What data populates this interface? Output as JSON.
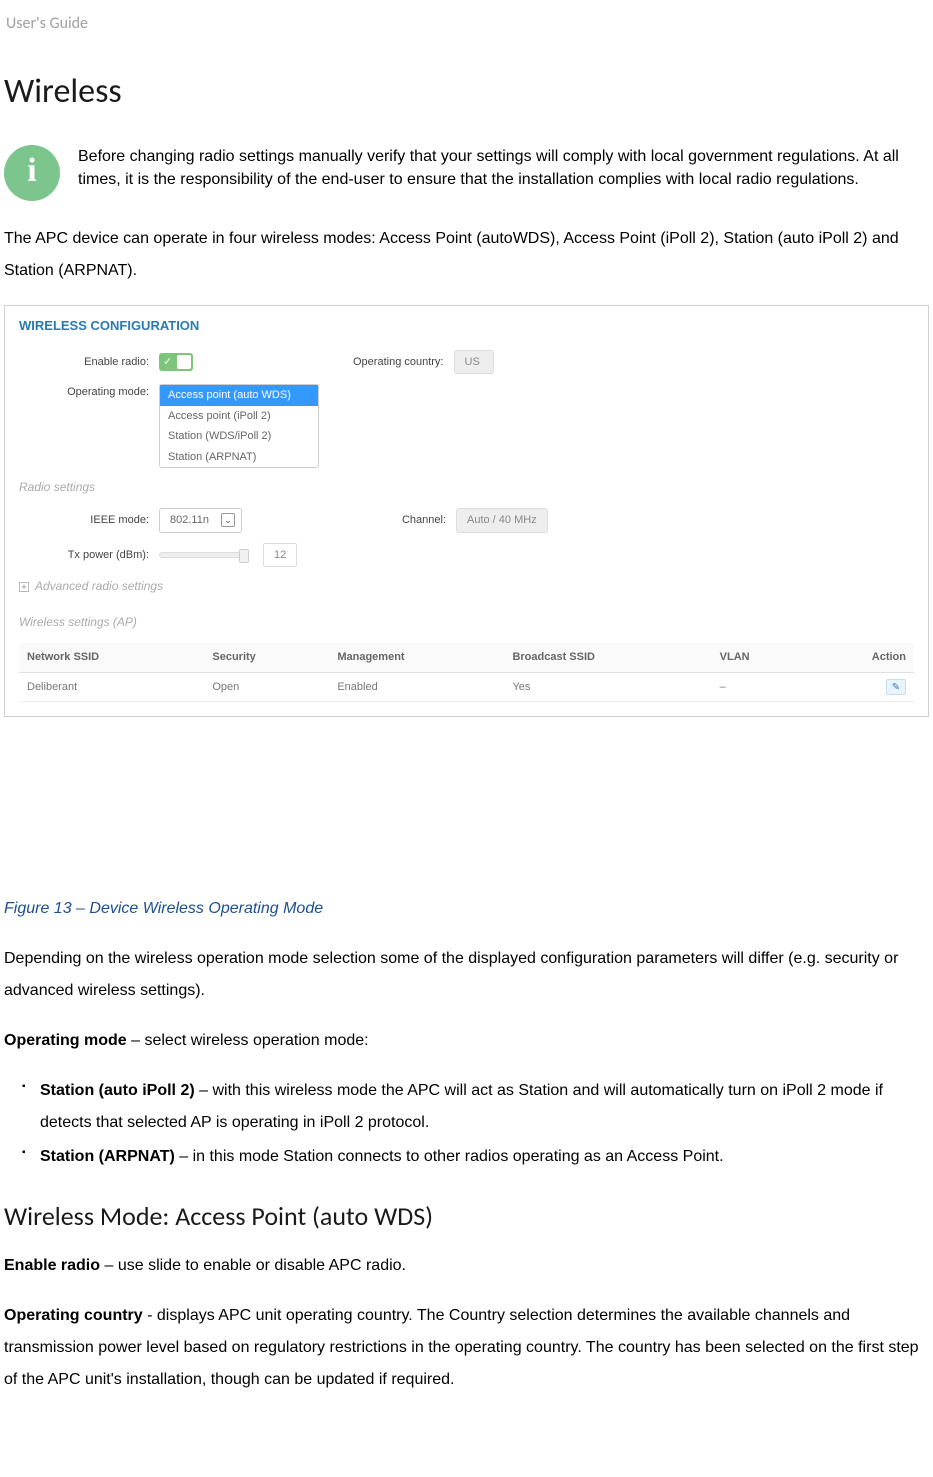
{
  "header": {
    "title": "User's Guide"
  },
  "h1": "Wireless",
  "info_note": "Before changing radio settings manually verify that your settings will comply with local government regulations. At all times, it is the responsibility of the end-user to ensure that the installation complies with local radio regulations.",
  "para1": "The APC device can operate in four wireless modes: Access Point (autoWDS), Access Point (iPoll 2), Station (auto iPoll 2) and Station (ARPNAT).",
  "screenshot": {
    "title": "WIRELESS CONFIGURATION",
    "labels": {
      "enable_radio": "Enable radio:",
      "operating_country": "Operating country:",
      "operating_mode": "Operating mode:",
      "radio_settings": "Radio settings",
      "ieee_mode": "IEEE mode:",
      "channel": "Channel:",
      "tx_power": "Tx power (dBm):",
      "advanced": "Advanced radio settings",
      "wireless_settings": "Wireless settings (AP)"
    },
    "values": {
      "country": "US",
      "mode_options": [
        "Access point (auto WDS)",
        "Access point (iPoll 2)",
        "Station (WDS/iPoll 2)",
        "Station (ARPNAT)"
      ],
      "mode_selected_index": 0,
      "ieee_mode": "802.11n",
      "channel": "Auto / 40 MHz",
      "tx_power": "12"
    },
    "table": {
      "headers": {
        "ssid": "Network SSID",
        "security": "Security",
        "mgmt": "Management",
        "broadcast": "Broadcast SSID",
        "vlan": "VLAN",
        "action": "Action"
      },
      "rows": [
        {
          "ssid": "Deliberant",
          "security": "Open",
          "mgmt": "Enabled",
          "broadcast": "Yes",
          "vlan": "–"
        }
      ]
    }
  },
  "figure_caption": "Figure 13 – Device Wireless Operating Mode",
  "para2": "Depending on the wireless operation mode selection some of the displayed configuration parameters will differ (e.g. security or advanced wireless settings).",
  "op_mode_label": "Operating mode",
  "op_mode_desc": " – select wireless operation mode:",
  "bullets": [
    {
      "bold": "Station (auto iPoll 2)",
      "text": " – with this wireless mode the APC will act as Station and will automatically turn on iPoll 2 mode if detects that selected AP is operating in iPoll 2 protocol."
    },
    {
      "bold": "Station (ARPNAT)",
      "text": " – in this mode Station connects to other radios operating as an Access Point."
    }
  ],
  "h2": "Wireless Mode: Access Point (auto WDS)",
  "enable_radio_label": "Enable radio",
  "enable_radio_desc": " – use slide to enable or disable APC radio.",
  "op_country_label": "Operating country",
  "op_country_desc": " - displays APC unit operating country. The Country selection determines the available channels and transmission power level based on regulatory restrictions in the operating country. The country has been selected on the first step of the APC unit's installation, though can be updated if required."
}
